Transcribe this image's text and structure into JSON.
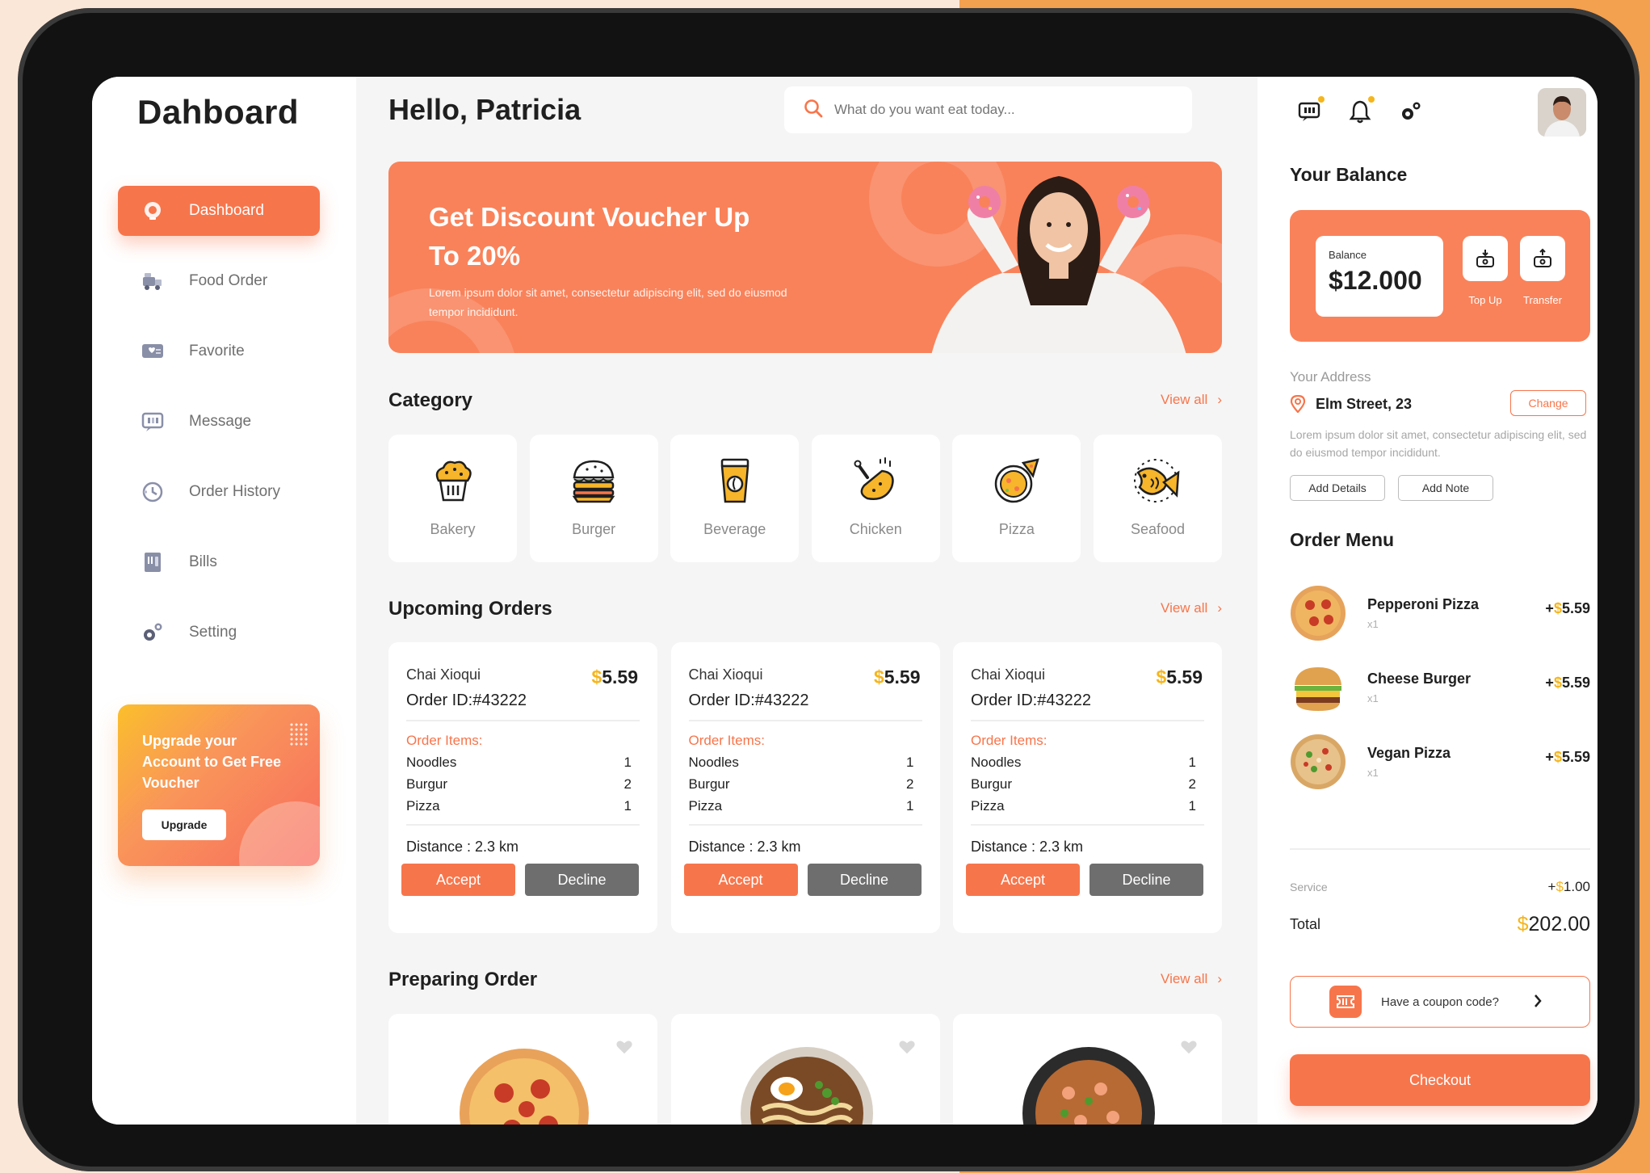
{
  "sidebar": {
    "logo": "Dahboard",
    "nav": [
      {
        "label": "Dashboard",
        "icon": "dashboard-icon",
        "active": true
      },
      {
        "label": "Food Order",
        "icon": "food-order-icon"
      },
      {
        "label": "Favorite",
        "icon": "favorite-icon"
      },
      {
        "label": "Message",
        "icon": "message-icon"
      },
      {
        "label": "Order History",
        "icon": "order-history-icon"
      },
      {
        "label": "Bills",
        "icon": "bills-icon"
      },
      {
        "label": "Setting",
        "icon": "setting-icon"
      }
    ],
    "promo": {
      "text": "Upgrade your Account to Get Free Voucher",
      "button": "Upgrade"
    }
  },
  "header": {
    "greeting": "Hello, Patricia",
    "search_placeholder": "What do you want eat today..."
  },
  "banner": {
    "title": "Get Discount Voucher Up To 20%",
    "subtitle": "Lorem ipsum dolor sit amet, consectetur adipiscing elit, sed do eiusmod tempor incididunt."
  },
  "category": {
    "title": "Category",
    "view_all": "View all",
    "items": [
      {
        "label": "Bakery",
        "icon": "bakery-icon"
      },
      {
        "label": "Burger",
        "icon": "burger-icon"
      },
      {
        "label": "Beverage",
        "icon": "beverage-icon"
      },
      {
        "label": "Chicken",
        "icon": "chicken-icon"
      },
      {
        "label": "Pizza",
        "icon": "pizza-icon"
      },
      {
        "label": "Seafood",
        "icon": "seafood-icon"
      }
    ]
  },
  "upcoming": {
    "title": "Upcoming Orders",
    "view_all": "View all",
    "orders": [
      {
        "name": "Chai Xioqui",
        "currency": "$",
        "price": "5.59",
        "order_id": "Order ID:#43222",
        "items_label": "Order Items:",
        "items": [
          {
            "name": "Noodles",
            "qty": "1"
          },
          {
            "name": "Burgur",
            "qty": "2"
          },
          {
            "name": "Pizza",
            "qty": "1"
          }
        ],
        "distance": "Distance : 2.3 km",
        "accept": "Accept",
        "decline": "Decline"
      },
      {
        "name": "Chai Xioqui",
        "currency": "$",
        "price": "5.59",
        "order_id": "Order ID:#43222",
        "items_label": "Order Items:",
        "items": [
          {
            "name": "Noodles",
            "qty": "1"
          },
          {
            "name": "Burgur",
            "qty": "2"
          },
          {
            "name": "Pizza",
            "qty": "1"
          }
        ],
        "distance": "Distance : 2.3 km",
        "accept": "Accept",
        "decline": "Decline"
      },
      {
        "name": "Chai Xioqui",
        "currency": "$",
        "price": "5.59",
        "order_id": "Order ID:#43222",
        "items_label": "Order Items:",
        "items": [
          {
            "name": "Noodles",
            "qty": "1"
          },
          {
            "name": "Burgur",
            "qty": "2"
          },
          {
            "name": "Pizza",
            "qty": "1"
          }
        ],
        "distance": "Distance : 2.3 km",
        "accept": "Accept",
        "decline": "Decline"
      }
    ]
  },
  "preparing": {
    "title": "Preparing Order",
    "view_all": "View all"
  },
  "right": {
    "balance_title": "Your Balance",
    "balance_label": "Balance",
    "balance_value": "$12.000",
    "top_up": "Top Up",
    "transfer": "Transfer",
    "address_label": "Your Address",
    "address": "Elm Street, 23",
    "change": "Change",
    "address_desc": "Lorem ipsum dolor sit amet, consectetur adipiscing elit, sed do eiusmod tempor incididunt.",
    "add_details": "Add Details",
    "add_note": "Add Note",
    "order_menu_title": "Order Menu",
    "menu": [
      {
        "name": "Pepperoni Pizza",
        "qty": "x1",
        "sign": "+",
        "currency": "$",
        "price": "5.59"
      },
      {
        "name": "Cheese Burger",
        "qty": "x1",
        "sign": "+",
        "currency": "$",
        "price": "5.59"
      },
      {
        "name": "Vegan Pizza",
        "qty": "x1",
        "sign": "+",
        "currency": "$",
        "price": "5.59"
      }
    ],
    "service_label": "Service",
    "service_sign": "+",
    "service_currency": "$",
    "service_value": "1.00",
    "total_label": "Total",
    "total_currency": "$",
    "total_value": "202.00",
    "coupon": "Have a coupon code?",
    "checkout": "Checkout"
  },
  "colors": {
    "accent": "#f7754b",
    "gold": "#f5b51c",
    "decline": "#6e6e6e"
  }
}
